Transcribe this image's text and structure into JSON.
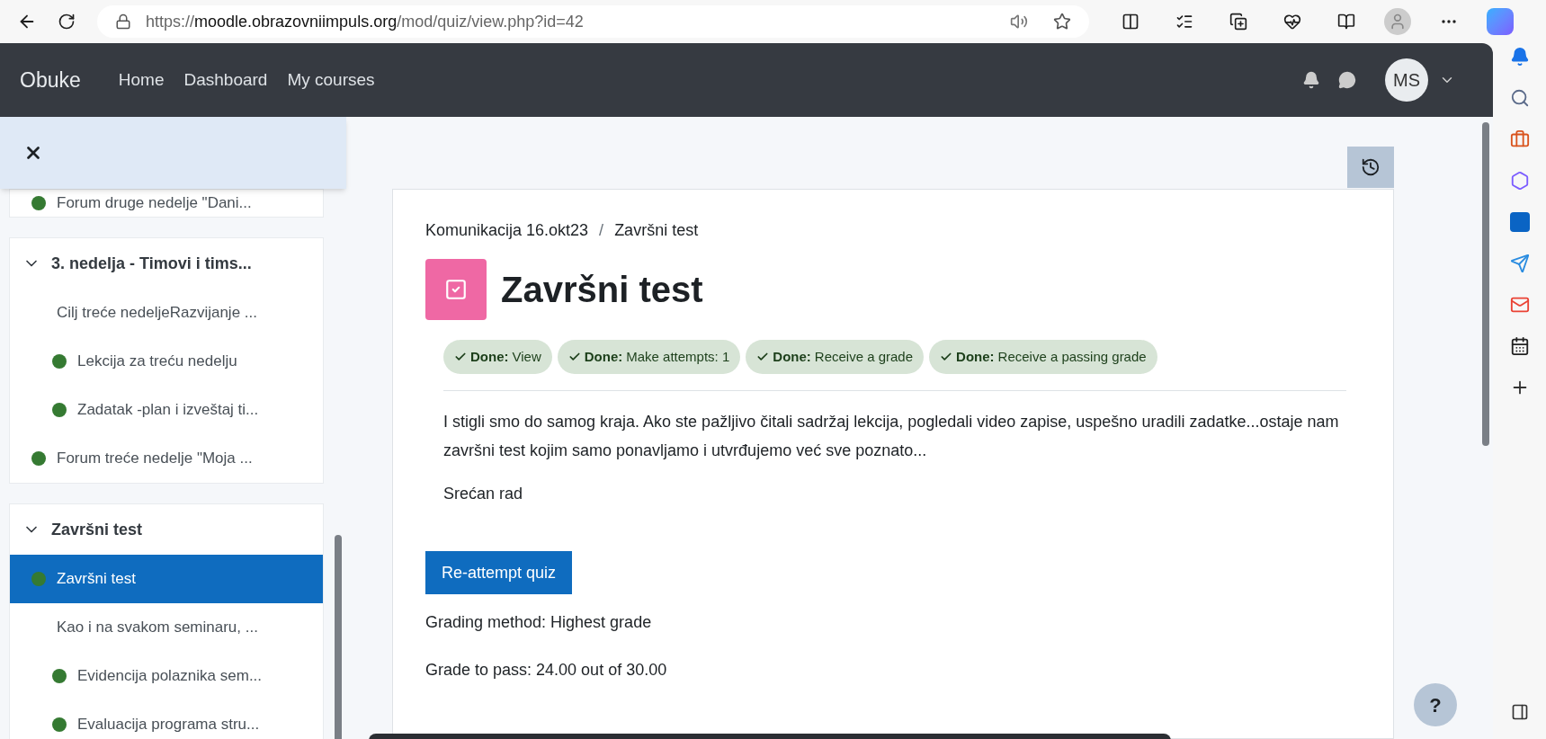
{
  "browser": {
    "url_scheme": "https://",
    "url_host": "moodle.obrazovniimpuls.org",
    "url_path": "/mod/quiz/view.php?id=42"
  },
  "navbar": {
    "brand": "Obuke",
    "links": [
      "Home",
      "Dashboard",
      "My courses"
    ],
    "avatar": "MS"
  },
  "sidebar": {
    "sections": [
      {
        "items": [
          {
            "label": "Forum druge nedelje \"Dani...",
            "done": true,
            "indented": false,
            "selected": false
          }
        ]
      },
      {
        "title": "3. nedelja - Timovi i tims...",
        "expanded": true,
        "items": [
          {
            "label": "Cilj treće nedeljeRazvijanje ...",
            "done": false,
            "indented": false,
            "selected": false
          },
          {
            "label": "Lekcija za treću nedelju",
            "done": true,
            "indented": true,
            "selected": false
          },
          {
            "label": "Zadatak -plan i izveštaj ti...",
            "done": true,
            "indented": true,
            "selected": false
          },
          {
            "label": "Forum treće nedelje \"Moja ...",
            "done": true,
            "indented": false,
            "selected": false
          }
        ]
      },
      {
        "title": "Završni test",
        "expanded": true,
        "items": [
          {
            "label": "Završni test",
            "done": true,
            "indented": false,
            "selected": true
          },
          {
            "label": "Kao i na svakom seminaru, ...",
            "done": false,
            "indented": false,
            "selected": false
          },
          {
            "label": "Evidencija polaznika sem...",
            "done": true,
            "indented": true,
            "selected": false
          },
          {
            "label": "Evaluacija programa stru...",
            "done": true,
            "indented": true,
            "selected": false
          }
        ]
      }
    ]
  },
  "breadcrumb": {
    "items": [
      "Komunikacija 16.okt23",
      "Završni test"
    ],
    "separator": "/"
  },
  "title": "Završni test",
  "completion": [
    {
      "label": "Done:",
      "condition": "View",
      "done": true
    },
    {
      "label": "Done:",
      "condition": "Make attempts: 1",
      "done": true
    },
    {
      "label": "Done:",
      "condition": "Receive a grade",
      "done": true
    },
    {
      "label": "Done:",
      "condition": "Receive a passing grade",
      "done": true
    }
  ],
  "description": [
    "I stigli smo do samog kraja. Ako ste pažljivo čitali sadržaj lekcija, pogledali video zapise, uspešno uradili zadatke...ostaje nam završni test kojim samo ponavljamo i utvrđujemo već sve poznato...",
    "Srećan rad"
  ],
  "action_button": "Re-attempt quiz",
  "info": [
    "Grading method: Highest grade",
    "Grade to pass: 24.00 out of 30.00"
  ],
  "help_button": "?"
}
